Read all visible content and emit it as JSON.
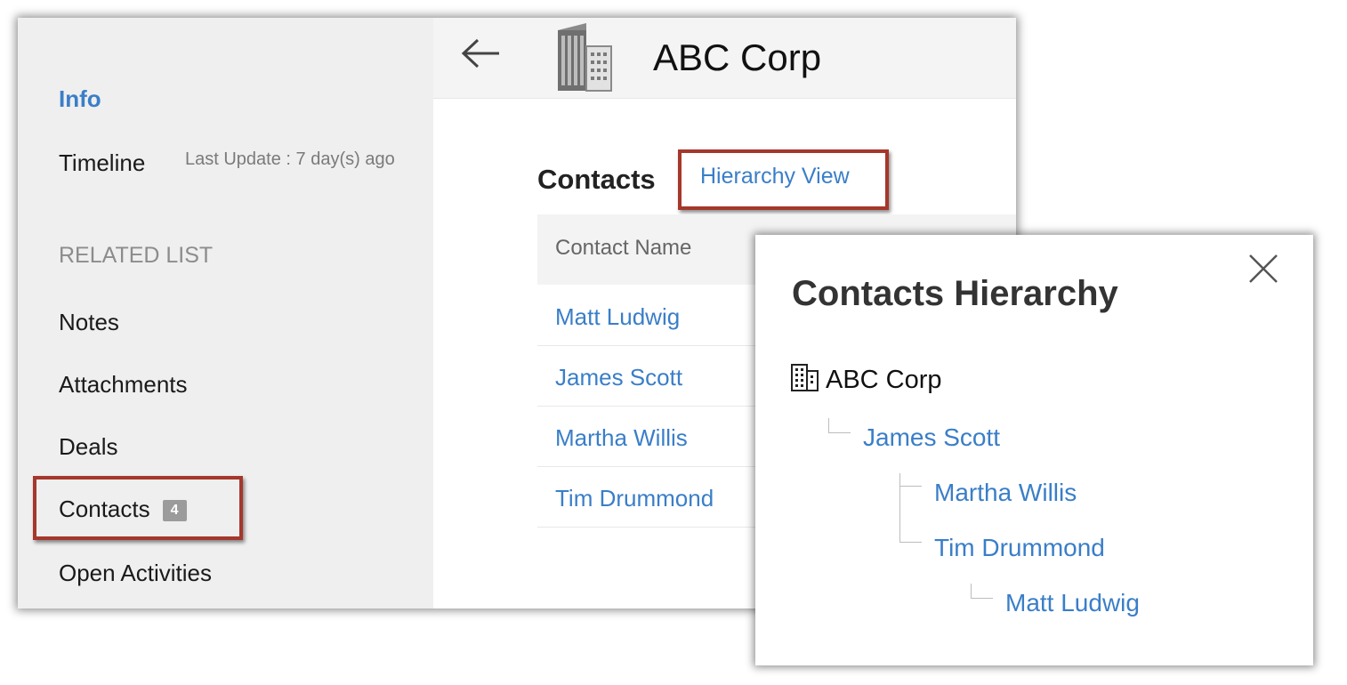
{
  "sidebar": {
    "info_label": "Info",
    "timeline_label": "Timeline",
    "last_update": "Last Update : 7 day(s) ago",
    "related_list_heading": "RELATED LIST",
    "items": [
      {
        "label": "Notes"
      },
      {
        "label": "Attachments"
      },
      {
        "label": "Deals"
      },
      {
        "label": "Contacts",
        "count": "4"
      },
      {
        "label": "Open Activities"
      }
    ]
  },
  "header": {
    "back_icon": "back-arrow-icon",
    "record_icon": "building-icon",
    "title": "ABC Corp"
  },
  "contacts_section": {
    "heading": "Contacts",
    "hierarchy_link": "Hierarchy View",
    "column_header": "Contact Name",
    "rows": [
      "Matt Ludwig",
      "James Scott",
      "Martha Willis",
      "Tim Drummond"
    ]
  },
  "hierarchy_popup": {
    "title": "Contacts Hierarchy",
    "close_icon": "close-icon",
    "root": "ABC Corp",
    "nodes": [
      {
        "name": "James Scott",
        "level": 1
      },
      {
        "name": "Martha Willis",
        "level": 2
      },
      {
        "name": "Tim Drummond",
        "level": 2
      },
      {
        "name": "Matt Ludwig",
        "level": 3
      }
    ]
  },
  "colors": {
    "link": "#3a7ec8",
    "highlight": "#a5372b",
    "sidebar_bg": "#efefef"
  }
}
